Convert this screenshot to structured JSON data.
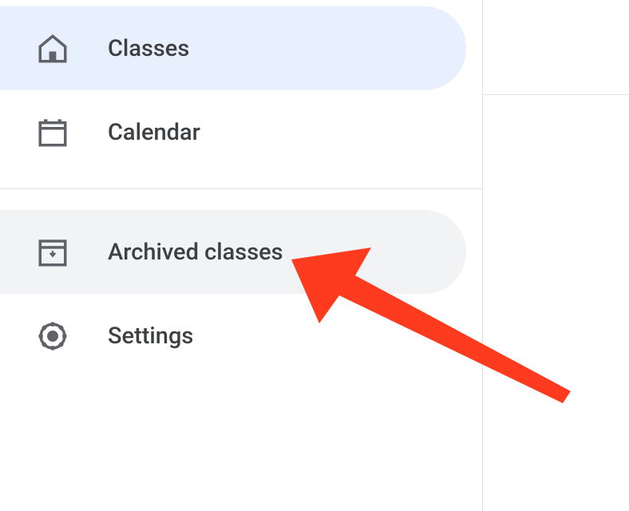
{
  "sidebar": {
    "items": [
      {
        "label": "Classes",
        "icon": "home",
        "active": true,
        "hover": false
      },
      {
        "label": "Calendar",
        "icon": "calendar",
        "active": false,
        "hover": false
      },
      {
        "label": "Archived classes",
        "icon": "archive",
        "active": false,
        "hover": true
      },
      {
        "label": "Settings",
        "icon": "settings",
        "active": false,
        "hover": false
      }
    ]
  },
  "annotation": {
    "type": "arrow",
    "color": "#ff3b1f",
    "target": "archived-classes"
  }
}
